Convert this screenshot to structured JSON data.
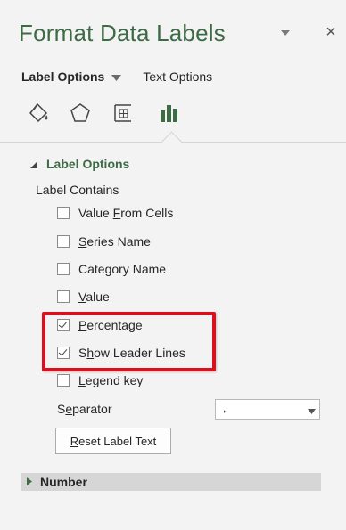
{
  "pane": {
    "title": "Format Data Labels",
    "close_glyph": "×",
    "accent_color": "#3d6b46"
  },
  "tabs": [
    {
      "label": "Label Options",
      "selected": true
    },
    {
      "label": "Text Options",
      "selected": false
    }
  ],
  "category_icons": [
    "fill-line-icon",
    "effects-icon",
    "size-properties-icon",
    "label-options-icon"
  ],
  "section": {
    "title": "Label Options",
    "expanded": true
  },
  "label_contains": {
    "heading": "Label Contains"
  },
  "checkboxes": [
    {
      "label": "Value From Cells",
      "ul_pre": "Value ",
      "ul_char": "F",
      "ul_post": "rom Cells",
      "checked": false
    },
    {
      "label": "Series Name",
      "ul_pre": "",
      "ul_char": "S",
      "ul_post": "eries Name",
      "checked": false
    },
    {
      "label": "Category Name",
      "ul_pre": "Cate",
      "ul_char": "g",
      "ul_post": "ory Name",
      "checked": false
    },
    {
      "label": "Value",
      "ul_pre": "",
      "ul_char": "V",
      "ul_post": "alue",
      "checked": false
    },
    {
      "label": "Percentage",
      "ul_pre": "",
      "ul_char": "P",
      "ul_post": "ercentage",
      "checked": true
    },
    {
      "label": "Show Leader Lines",
      "ul_pre": "S",
      "ul_char": "h",
      "ul_post": "ow Leader Lines",
      "checked": true
    },
    {
      "label": "Legend key",
      "ul_pre": "",
      "ul_char": "L",
      "ul_post": "egend key",
      "checked": false
    }
  ],
  "separator": {
    "pre": "S",
    "ul": "e",
    "post": "parator",
    "value": ","
  },
  "reset_button": {
    "pre": "",
    "ul": "R",
    "post": "eset Label Text"
  },
  "number_section": {
    "title": "Number",
    "expanded": false
  },
  "highlight_color": "#d9101e"
}
